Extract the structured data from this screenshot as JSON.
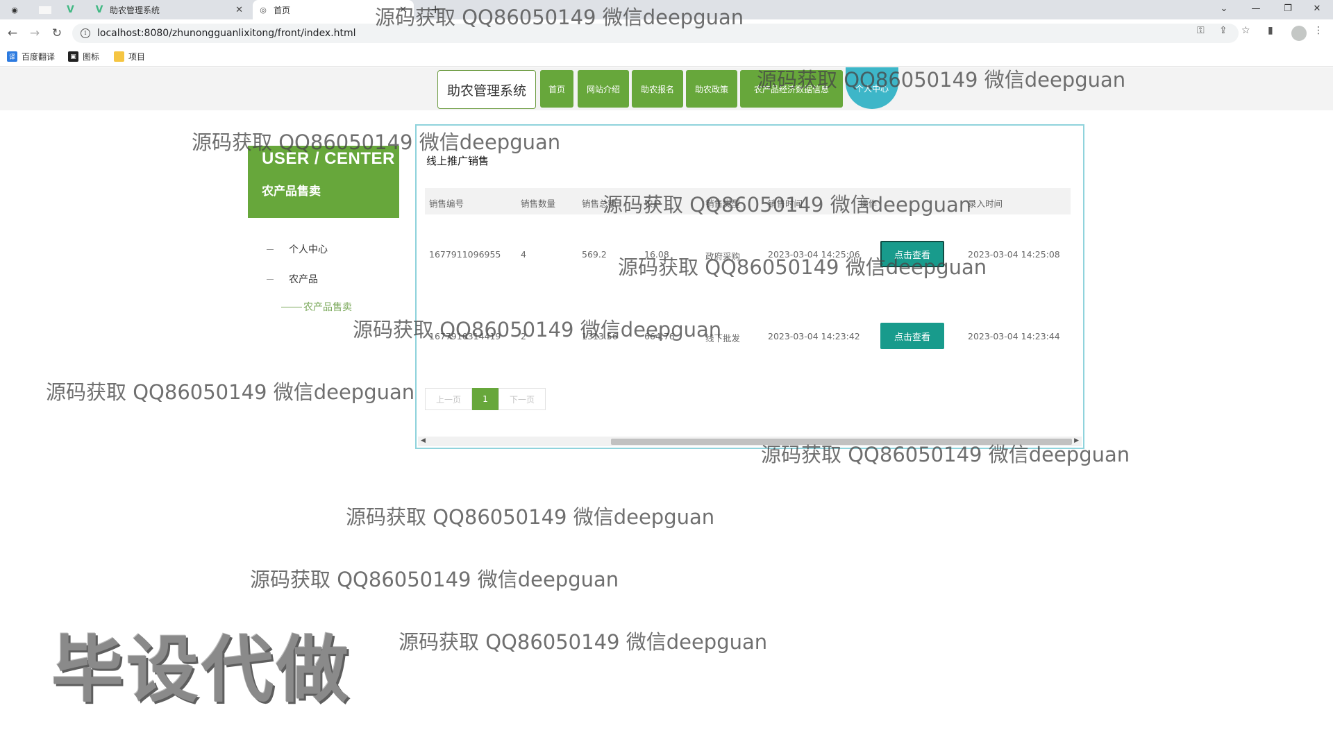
{
  "browser": {
    "tabs": [
      {
        "label": "助农管理系统",
        "icon": "vue-logo-icon"
      },
      {
        "label": "首页",
        "icon": "globe-icon"
      }
    ],
    "url": "localhost:8080/zhunongguanlixitong/front/index.html",
    "bookmarks": [
      {
        "label": "百度翻译",
        "icon": "translate-icon"
      },
      {
        "label": "图标",
        "icon": "image-icon"
      },
      {
        "label": "项目",
        "icon": "folder-icon"
      }
    ]
  },
  "nav": {
    "brand": "助农管理系统",
    "items": [
      "首页",
      "网站介绍",
      "助农报名",
      "助农政策",
      "农产品经济数据信息"
    ],
    "user_center": "个人中心"
  },
  "sidebar": {
    "title": "USER / CENTER",
    "subtitle": "农产品售卖",
    "items": [
      "个人中心",
      "农产品"
    ],
    "active_sub": "农产品售卖"
  },
  "panel": {
    "title": "线上推广销售",
    "columns": [
      "销售编号",
      "销售数量",
      "销售总额",
      "农户",
      "销售类型",
      "销售时间",
      "操作",
      "录入时间"
    ],
    "rows": [
      {
        "no": "1677911096955",
        "qty": "4",
        "total": "569.2",
        "farmer": "16.08",
        "type": "政府采购",
        "time": "2023-03-04 14:25:06",
        "action": "点击查看",
        "created": "2023-03-04 14:25:08"
      },
      {
        "no": "1677910314419",
        "qty": "2",
        "total": "1313.56",
        "farmer": "664.76",
        "type": "线下批发",
        "time": "2023-03-04 14:23:42",
        "action": "点击查看",
        "created": "2023-03-04 14:23:44"
      }
    ],
    "pager": {
      "prev": "上一页",
      "current": "1",
      "next": "下一页"
    }
  },
  "watermark": "源码获取 QQ86050149 微信deepguan",
  "stamp": "毕设代做",
  "colors": {
    "primary_green": "#67a73b",
    "teal_button": "#189b8c",
    "cyan_circle": "#3db6c8",
    "panel_border": "#8fd3dc"
  }
}
